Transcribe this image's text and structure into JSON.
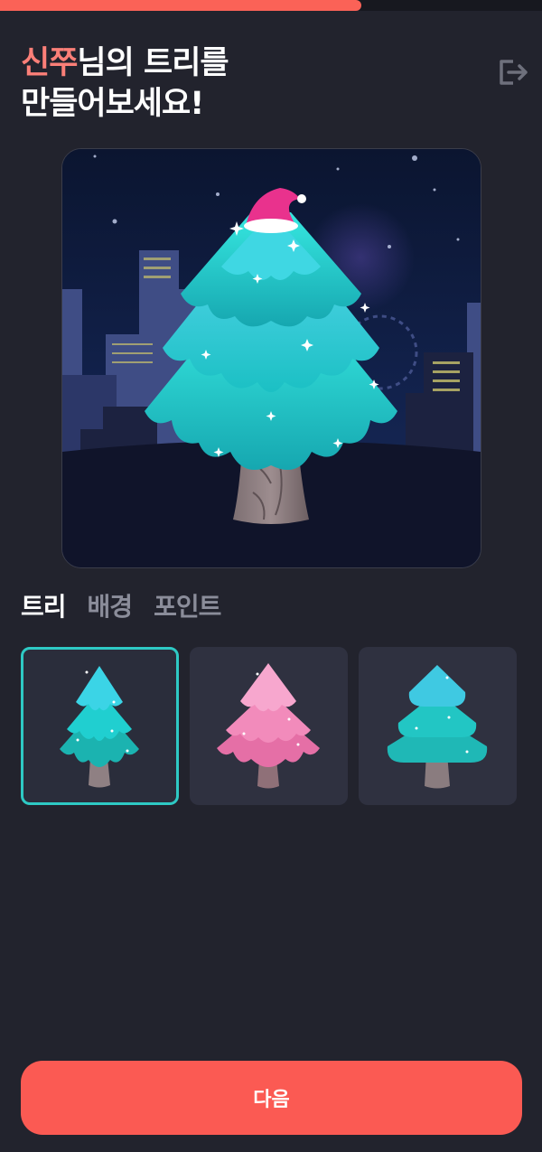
{
  "progress": {
    "fraction": 0.667
  },
  "header": {
    "user_name": "신쭈",
    "title_line1_suffix": "님의 트리를",
    "title_line2": "만들어보세요!"
  },
  "icons": {
    "exit": "logout-icon"
  },
  "colors": {
    "accent": "#fb5a53",
    "name_highlight": "#fb7f78",
    "selected_border": "#2ec9c4",
    "background": "#22232d",
    "card": "#2f3140"
  },
  "tabs": [
    {
      "label": "트리",
      "active": true
    },
    {
      "label": "배경",
      "active": false
    },
    {
      "label": "포인트",
      "active": false
    }
  ],
  "options": [
    {
      "name": "teal-sparkle-tree",
      "selected": true
    },
    {
      "name": "pink-tree",
      "selected": false
    },
    {
      "name": "teal-wide-tree",
      "selected": false
    }
  ],
  "footer": {
    "next_label": "다음"
  }
}
